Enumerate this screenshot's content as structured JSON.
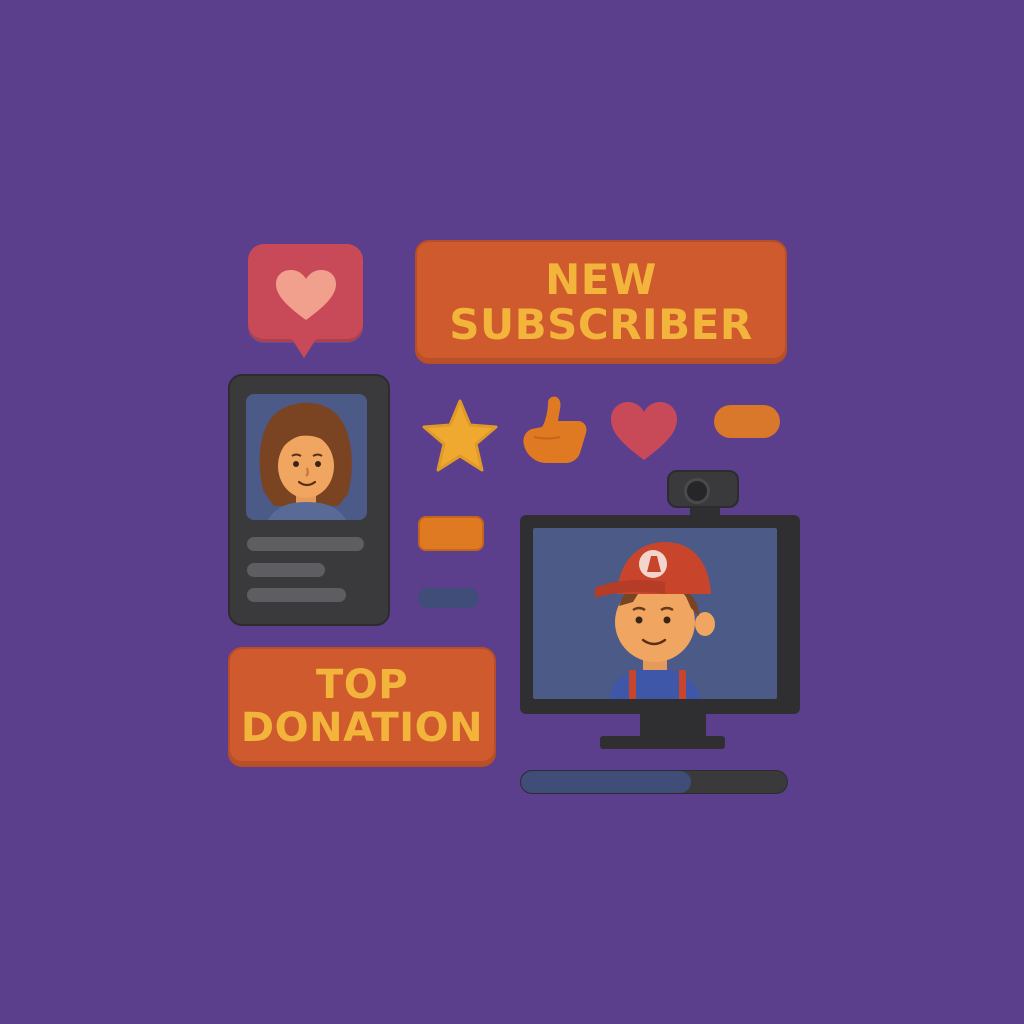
{
  "banners": {
    "new_subscriber": {
      "line1": "NEW",
      "line2": "SUBSCRIBER"
    },
    "top_donation": {
      "line1": "TOP",
      "line2": "DONATION"
    }
  },
  "icons": [
    "heart-icon",
    "star-icon",
    "thumbs-up-icon",
    "webcam-icon"
  ],
  "progress": {
    "value": 0.64
  },
  "colors": {
    "background": "#5b3f8d",
    "banner": "#cf5a2e",
    "banner_text": "#f2b43a",
    "heart": "#c84a58",
    "star": "#efa931",
    "accent_orange": "#e07a22",
    "screen": "#4b5a86"
  }
}
